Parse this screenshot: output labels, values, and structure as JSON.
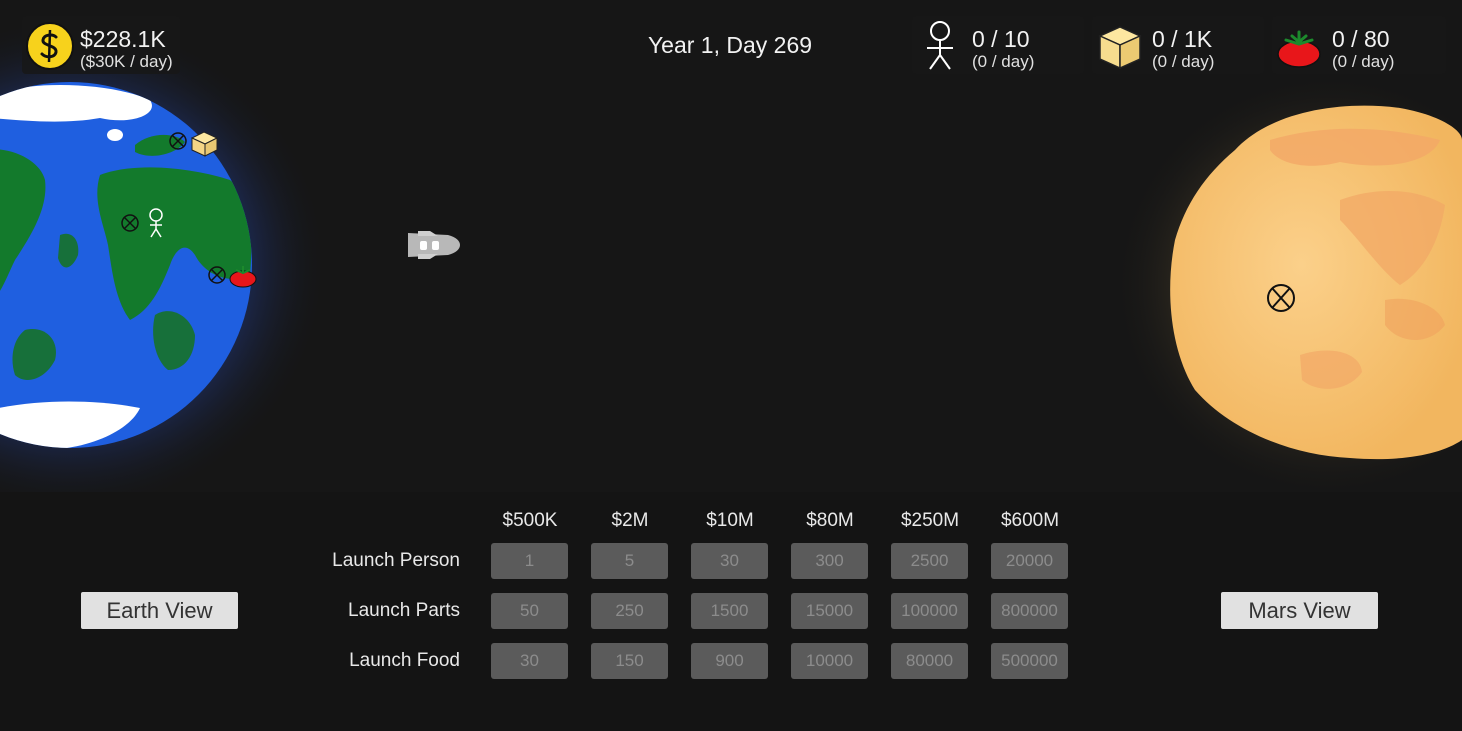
{
  "hud": {
    "money": {
      "value": "$228.1K",
      "rate": "($30K / day)",
      "icon": "dollar-coin-icon"
    },
    "date": "Year 1, Day 269",
    "people": {
      "value": "0 / 10",
      "rate": "(0 / day)",
      "icon": "stick-person-icon"
    },
    "parts": {
      "value": "0 / 1K",
      "rate": "(0 / day)",
      "icon": "crate-icon"
    },
    "food": {
      "value": "0 / 80",
      "rate": "(0 / day)",
      "icon": "tomato-icon"
    }
  },
  "launch": {
    "costs": [
      "$500K",
      "$2M",
      "$10M",
      "$80M",
      "$250M",
      "$600M"
    ],
    "rows": [
      {
        "label": "Launch Person",
        "amounts": [
          "1",
          "5",
          "30",
          "300",
          "2500",
          "20000"
        ]
      },
      {
        "label": "Launch Parts",
        "amounts": [
          "50",
          "250",
          "1500",
          "15000",
          "100000",
          "800000"
        ]
      },
      {
        "label": "Launch Food",
        "amounts": [
          "30",
          "150",
          "900",
          "10000",
          "80000",
          "500000"
        ]
      }
    ]
  },
  "views": {
    "earth": "Earth View",
    "mars": "Mars View"
  },
  "colors": {
    "earth_ocean": "#1f5fe0",
    "earth_land": "#137a2c",
    "mars": "#f6c470",
    "coin": "#f7d21c",
    "tomato": "#e8161a",
    "button": "#5b5b5b"
  }
}
